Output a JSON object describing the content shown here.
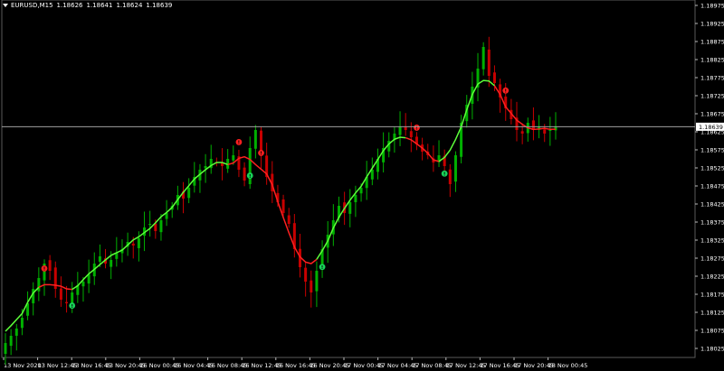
{
  "header": {
    "symbol_timeframe": "EURUSD,M15",
    "open": "1.18626",
    "high": "1.18641",
    "low": "1.18624",
    "close": "1.18639"
  },
  "price_axis": {
    "labels": [
      "1.18975",
      "1.18925",
      "1.18875",
      "1.18825",
      "1.18775",
      "1.18725",
      "1.18675",
      "1.18625",
      "1.18575",
      "1.18525",
      "1.18475",
      "1.18425",
      "1.18375",
      "1.18325",
      "1.18275",
      "1.18225",
      "1.18175",
      "1.18125",
      "1.18075",
      "1.18025"
    ],
    "current_price": "1.18639"
  },
  "time_axis": {
    "labels": [
      "13 Nov 2020",
      "13 Nov 12:45",
      "13 Nov 16:45",
      "13 Nov 20:45",
      "16 Nov 00:45",
      "16 Nov 04:45",
      "16 Nov 08:45",
      "16 Nov 12:45",
      "16 Nov 16:45",
      "16 Nov 20:45",
      "17 Nov 00:45",
      "17 Nov 04:45",
      "17 Nov 08:45",
      "17 Nov 12:45",
      "17 Nov 16:45",
      "17 Nov 20:45",
      "18 Nov 00:45"
    ]
  },
  "colors": {
    "background": "#000000",
    "bull_candle": "#00b000",
    "bear_candle": "#c80000",
    "ma_up": "#5cff3a",
    "ma_down": "#ff2020",
    "buy_signal": "#19d35a",
    "sell_signal": "#ff2020",
    "axis_text": "#ffffff",
    "bid_line": "#a0a0a0"
  },
  "chart_data": {
    "type": "candlestick",
    "instrument": "EURUSD",
    "timeframe": "M15",
    "candles_close": [
      1.1804,
      1.1806,
      1.1808,
      1.1811,
      1.1815,
      1.1819,
      1.1822,
      1.1826,
      1.1824,
      1.1819,
      1.1816,
      1.1815,
      1.1818,
      1.182,
      1.1821,
      1.1823,
      1.1826,
      1.1828,
      1.1826,
      1.1827,
      1.1829,
      1.183,
      1.1832,
      1.1831,
      1.1833,
      1.1836,
      1.1837,
      1.1835,
      1.1838,
      1.184,
      1.1842,
      1.1845,
      1.1844,
      1.1847,
      1.185,
      1.1852,
      1.1853,
      1.1855,
      1.1854,
      1.1853,
      1.1855,
      1.1856,
      1.1852,
      1.1849,
      1.1858,
      1.1863,
      1.1856,
      1.185,
      1.1846,
      1.1843,
      1.184,
      1.1837,
      1.183,
      1.1825,
      1.1821,
      1.1818,
      1.1824,
      1.183,
      1.1834,
      1.1838,
      1.1842,
      1.184,
      1.1843,
      1.1845,
      1.1847,
      1.185,
      1.1852,
      1.1855,
      1.1858,
      1.186,
      1.1862,
      1.1864,
      1.1863,
      1.1861,
      1.1859,
      1.1857,
      1.1856,
      1.1854,
      1.1856,
      1.1853,
      1.1848,
      1.1856,
      1.1865,
      1.187,
      1.1875,
      1.188,
      1.1886,
      1.1878,
      1.1876,
      1.1872,
      1.1869,
      1.1866,
      1.1863,
      1.1862,
      1.1865,
      1.1863,
      1.1864,
      1.1862,
      1.1863,
      1.18639
    ],
    "ma_segments": [
      {
        "trend": "up",
        "from": 0,
        "to": 6
      },
      {
        "trend": "down",
        "from": 6,
        "to": 12
      },
      {
        "trend": "up",
        "from": 12,
        "to": 40
      },
      {
        "trend": "down",
        "from": 40,
        "to": 56
      },
      {
        "trend": "up",
        "from": 56,
        "to": 72
      },
      {
        "trend": "down",
        "from": 72,
        "to": 78
      },
      {
        "trend": "up",
        "from": 78,
        "to": 88
      },
      {
        "trend": "down",
        "from": 88,
        "to": 99
      }
    ],
    "signals": [
      {
        "type": "sell",
        "index": 7
      },
      {
        "type": "buy",
        "index": 12
      },
      {
        "type": "sell",
        "index": 42
      },
      {
        "type": "buy",
        "index": 44
      },
      {
        "type": "sell",
        "index": 46
      },
      {
        "type": "buy",
        "index": 57
      },
      {
        "type": "sell",
        "index": 74
      },
      {
        "type": "buy",
        "index": 79
      },
      {
        "type": "sell",
        "index": 90
      }
    ],
    "ylim": [
      1.18,
      1.1899
    ]
  }
}
